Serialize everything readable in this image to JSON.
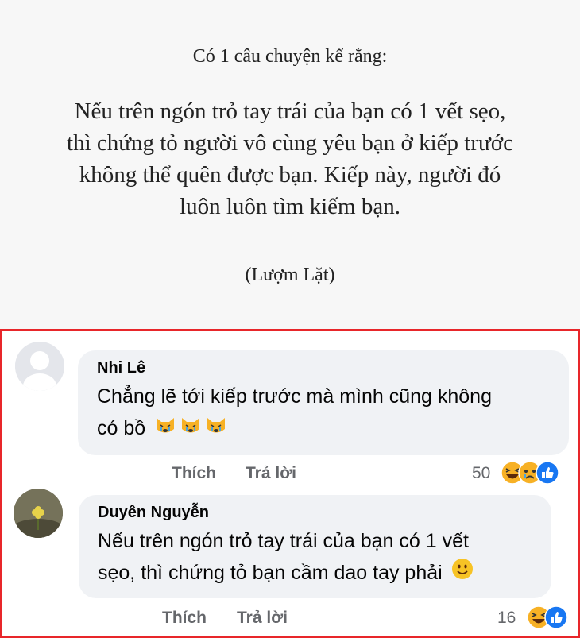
{
  "post": {
    "heading": "Có 1 câu chuyện kể rằng:",
    "lines": [
      "Nếu trên ngón trỏ tay trái của bạn có 1 vết sẹo,",
      "thì chứng tỏ người vô cùng yêu bạn ở kiếp trước",
      "không thể quên được bạn. Kiếp này, người đó",
      "luôn luôn tìm kiếm bạn."
    ],
    "source": "(Lượm Lặt)"
  },
  "comments": [
    {
      "author": "Nhi Lê",
      "lines": [
        "Chẳng lẽ tới kiếp trước mà mình cũng không",
        "có bồ"
      ],
      "trailing_emojis": [
        "crying-cat-icon",
        "crying-cat-icon",
        "crying-cat-icon"
      ],
      "like_label": "Thích",
      "reply_label": "Trả lời",
      "reaction_count": "50",
      "reactions": [
        "haha-icon",
        "sad-icon",
        "like-icon"
      ]
    },
    {
      "author": "Duyên Nguyễn",
      "lines": [
        "Nếu trên ngón trỏ tay trái của bạn có 1 vết",
        "sẹo, thì chứng tỏ bạn cầm dao tay phải"
      ],
      "trailing_emojis": [
        "smile-icon"
      ],
      "like_label": "Thích",
      "reply_label": "Trả lời",
      "reaction_count": "16",
      "reactions": [
        "haha-icon",
        "like-icon"
      ]
    }
  ],
  "colors": {
    "frame": "#e8262a",
    "bubble": "#f0f2f5",
    "like_blue": "#1877f2",
    "reaction_yellow": "#f7b125"
  }
}
